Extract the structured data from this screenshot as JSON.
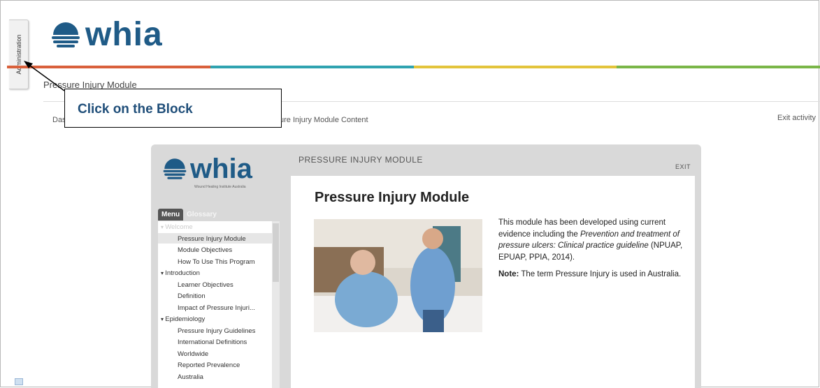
{
  "admin_tab": {
    "label": "Administration"
  },
  "brand": {
    "logo_text": "whia",
    "player_logo_text": "whia",
    "player_logo_sub": "Wound Healing Institute Australia"
  },
  "color_bar": {
    "colors": [
      "#d9603b",
      "#2fa3b0",
      "#e3c43b",
      "#7ab648"
    ]
  },
  "page": {
    "module_title": "Pressure Injury Module",
    "breadcrumb_start": "Das",
    "breadcrumb_end": "ure Injury Module Content",
    "exit_activity": "Exit activity"
  },
  "callout": {
    "text": "Click on the Block"
  },
  "player": {
    "header": "PRESSURE INJURY MODULE",
    "exit": "EXIT",
    "tabs": {
      "menu": "Menu",
      "glossary": "Glossary"
    },
    "menu": [
      {
        "label": "Welcome",
        "level": 0,
        "dim": true
      },
      {
        "label": "Pressure Injury Module",
        "level": 1,
        "selected": true
      },
      {
        "label": "Module Objectives",
        "level": 1
      },
      {
        "label": "How To Use This Program",
        "level": 1
      },
      {
        "label": "Introduction",
        "level": 0
      },
      {
        "label": "Learner Objectives",
        "level": 1
      },
      {
        "label": "Definition",
        "level": 1
      },
      {
        "label": "Impact of Pressure Injuri...",
        "level": 1
      },
      {
        "label": "Epidemiology",
        "level": 0
      },
      {
        "label": "Pressure Injury Guidelines",
        "level": 1
      },
      {
        "label": "International Definitions",
        "level": 1
      },
      {
        "label": "Worldwide",
        "level": 1
      },
      {
        "label": "Reported Prevalence",
        "level": 1
      },
      {
        "label": "Australia",
        "level": 1
      }
    ],
    "content": {
      "title": "Pressure Injury Module",
      "para1_a": "This module has been developed using current evidence including the ",
      "para1_italic": "Prevention and treatment of pressure ulcers: Clinical practice guideline",
      "para1_b": " (NPUAP, EPUAP, PPIA, 2014).",
      "note_label": "Note:",
      "note_text": " The term Pressure Injury is used in Australia."
    }
  }
}
